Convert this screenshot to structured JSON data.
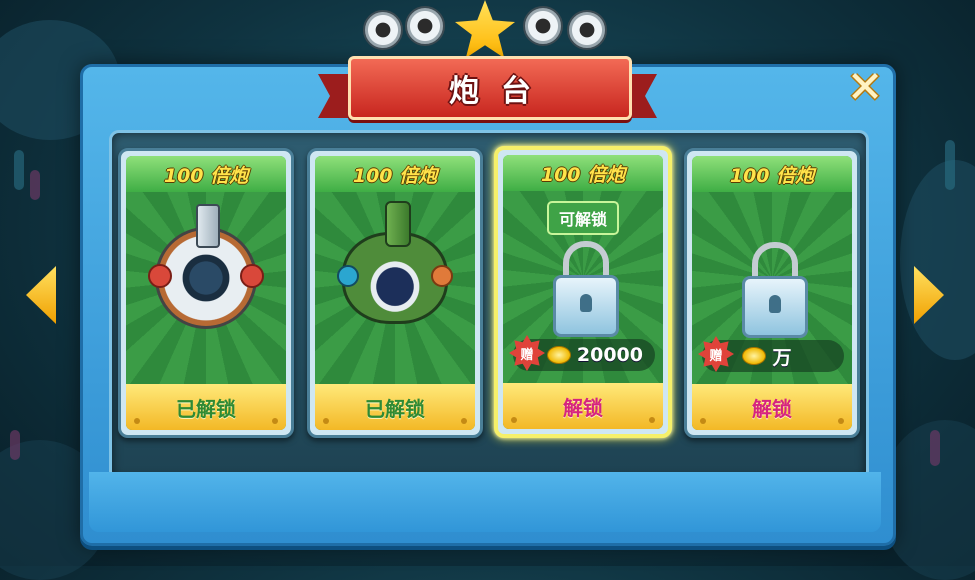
{
  "title": "炮台",
  "close_symbol": "✕",
  "cards": [
    {
      "header": "100 倍炮",
      "footer": "已解锁",
      "state": "unlocked",
      "cannon": "cannon-white-icon"
    },
    {
      "header": "100 倍炮",
      "footer": "已解锁",
      "state": "unlocked",
      "cannon": "cannon-green-icon"
    },
    {
      "header": "100 倍炮",
      "footer": "解锁",
      "state": "locked",
      "status": "可解锁",
      "gift": "赠",
      "price": "20000",
      "selected": true
    },
    {
      "header": "100 倍炮",
      "footer": "解锁",
      "state": "locked",
      "gift": "赠",
      "price": "万"
    }
  ],
  "colors": {
    "panel_blue": "#3fa2e0",
    "ribbon_red": "#d63328",
    "card_green": "#3b9c46",
    "footer_yellow": "#f3c93a",
    "unlocked_text": "#2f8a33",
    "unlock_text": "#d6247f",
    "selected_glow": "#f3ec4a"
  }
}
